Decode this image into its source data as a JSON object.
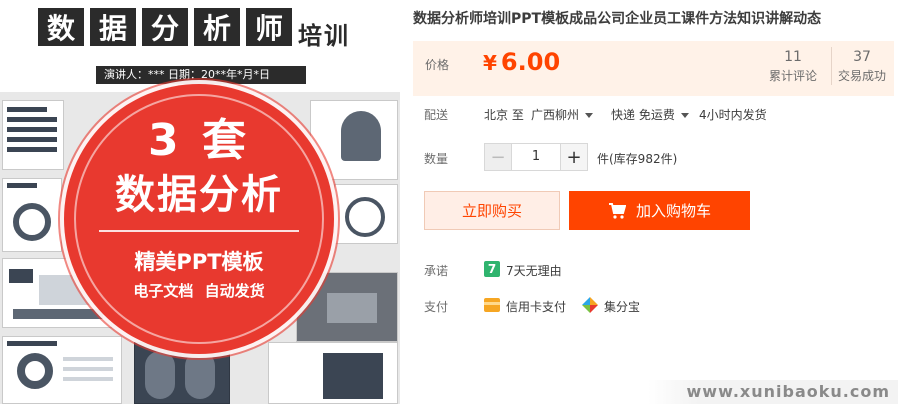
{
  "image": {
    "title_chars": [
      "数",
      "据",
      "分",
      "析",
      "师"
    ],
    "title_suffix": "培训",
    "speaker_bar": "演讲人：***   日期：20**年*月*日",
    "badge": {
      "line1": "3 套",
      "line2": "数据分析",
      "line3": "精美PPT模板",
      "line4": "电子文档 自动发货"
    }
  },
  "product": {
    "title": "数据分析师培训PPT模板成品公司企业员工课件方法知识讲解动态"
  },
  "price": {
    "label": "价格",
    "currency": "¥",
    "amount": "6.00",
    "reviews_count": "11",
    "reviews_label": "累计评论",
    "sales_count": "37",
    "sales_label": "交易成功"
  },
  "shipping": {
    "label": "配送",
    "from": "北京 至",
    "to": "广西柳州",
    "method": "快递 免运费",
    "dispatch": "4小时内发货"
  },
  "quantity": {
    "label": "数量",
    "value": "1",
    "minus": "−",
    "plus": "+",
    "stock": "件(库存982件)"
  },
  "actions": {
    "buy_now": "立即购买",
    "add_to_cart": "加入购物车"
  },
  "promise": {
    "label": "承诺",
    "icon_text": "7",
    "text": "7天无理由"
  },
  "payment": {
    "label": "支付",
    "credit_card": "信用卡支付",
    "points": "集分宝"
  },
  "watermark": "www.xunibaoku.com",
  "colors": {
    "accent": "#ff4400",
    "price_bg": "#fff2e8",
    "badge_red": "#e8392f",
    "promise_green": "#2fb46e"
  }
}
